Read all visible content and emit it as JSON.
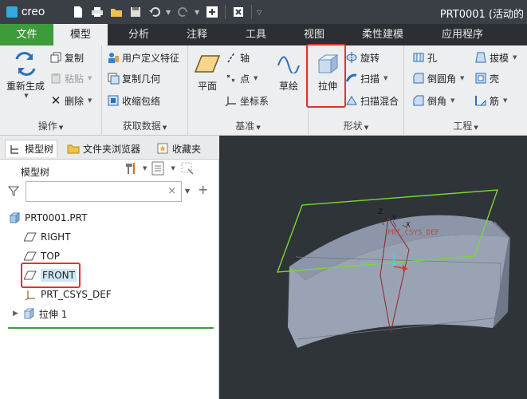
{
  "app": {
    "logo_text": "creo",
    "window_title": "PRT0001 (活动的"
  },
  "tabs": [
    "文件",
    "模型",
    "分析",
    "注释",
    "工具",
    "视图",
    "柔性建模",
    "应用程序"
  ],
  "ribbon": {
    "operations": {
      "label": "操作",
      "regenerate": "重新生成",
      "copy": "复制",
      "paste": "粘贴",
      "delete": "删除"
    },
    "get_data": {
      "label": "获取数据",
      "udf": "用户定义特征",
      "copy_geom": "复制几何",
      "shrinkwrap": "收缩包络"
    },
    "datum": {
      "label": "基准",
      "plane": "平面",
      "axis": "轴",
      "point": "点",
      "csys": "坐标系",
      "sketch": "草绘"
    },
    "shapes": {
      "label": "形状",
      "extrude": "拉伸",
      "revolve": "旋转",
      "sweep": "扫描",
      "swept_blend": "扫描混合"
    },
    "engineering": {
      "label": "工程",
      "hole": "孔",
      "round": "倒圆角",
      "chamfer": "倒角",
      "draft": "拔模",
      "shell": "壳",
      "rib": "筋"
    }
  },
  "panel": {
    "tabs": [
      "模型树",
      "文件夹浏览器",
      "收藏夹"
    ],
    "tree_header": "模型树",
    "search": {
      "value": "",
      "clear": "×"
    },
    "tree": [
      {
        "label": "PRT0001.PRT",
        "icon": "part-icon"
      },
      {
        "label": "RIGHT",
        "icon": "datum-plane-icon"
      },
      {
        "label": "TOP",
        "icon": "datum-plane-icon"
      },
      {
        "label": "FRONT",
        "icon": "datum-plane-icon",
        "selected": true
      },
      {
        "label": "PRT_CSYS_DEF",
        "icon": "csys-icon"
      },
      {
        "label": "拉伸 1",
        "icon": "extrude-feature-icon",
        "expandable": true
      }
    ]
  },
  "viewport": {
    "csys_label": "PRT_CSYS_DEF",
    "axis_z": "Z",
    "axis_y": "Y",
    "axis_x": "X"
  },
  "colors": {
    "file_tab": "#3e9b3a",
    "highlight_box": "#e0342e",
    "viewport_bg": "#2f3438",
    "model_surface": "#9aa3b3",
    "selected_plane": "#7ad63a"
  }
}
